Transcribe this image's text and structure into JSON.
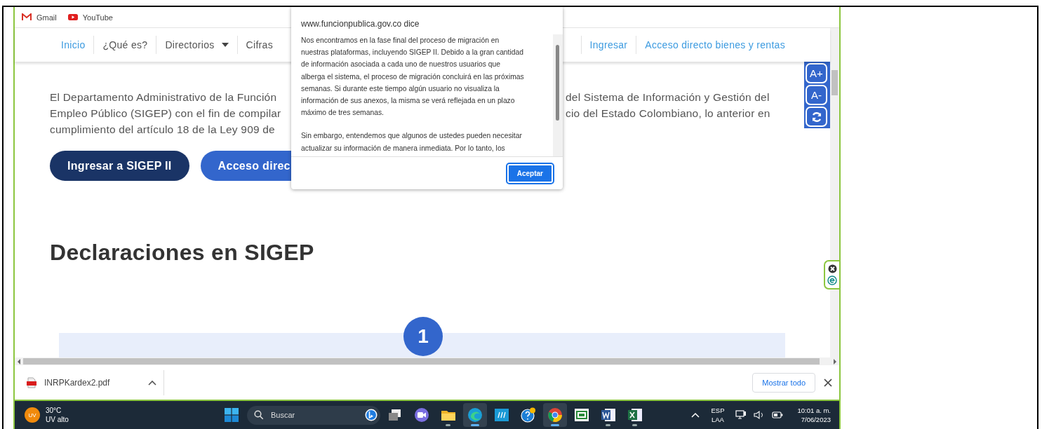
{
  "bookmarks": [
    {
      "label": "Gmail",
      "kind": "mail"
    },
    {
      "label": "YouTube",
      "kind": "video"
    }
  ],
  "nav": {
    "left_items": [
      {
        "label": "Inicio",
        "kind": "accent"
      },
      {
        "label": "¿Qué es?",
        "kind": "plain"
      },
      {
        "label": "Directorios",
        "kind": "dropdown"
      },
      {
        "label": "Cifras",
        "kind": "plain"
      }
    ],
    "right_items": [
      {
        "label": "Ingresar",
        "kind": "accent"
      },
      {
        "label": "Acceso directo bienes y rentas",
        "kind": "accent"
      }
    ]
  },
  "intro": {
    "lines": [
      {
        "left": "El Departamento Administrativo de la Función",
        "right": "del Sistema de Información y Gestión del"
      },
      {
        "left": "Empleo Público (SIGEP) con el fin de compilar",
        "right": "cio del Estado Colombiano, lo anterior en"
      },
      {
        "left": "cumplimiento del artículo 18 de la Ley 909 de"
      }
    ]
  },
  "buttons": [
    {
      "label": "Ingresar a SIGEP II",
      "kind": "dark"
    },
    {
      "label": "Acceso direc",
      "kind": "light"
    }
  ],
  "heading": "Declaraciones en SIGEP",
  "step_badge": "1",
  "font_tools": [
    "A+",
    "A-"
  ],
  "dialog": {
    "title": "www.funcionpublica.gov.co dice",
    "paragraphs": [
      [
        "Nos encontramos en la fase final del proceso de migración en",
        "nuestras plataformas, incluyendo SIGEP II. Debido a la gran cantidad",
        "de información asociada a cada uno de nuestros usuarios que",
        "alberga el sistema, el proceso de migración concluirá en las próximas",
        "semanas. Si durante este tiempo algún usuario no visualiza la",
        "información de sus anexos, la misma se verá reflejada en un plazo",
        "máximo de tres semanas."
      ],
      [
        "Sin embargo, entendemos que algunos de ustedes pueden necesitar",
        "actualizar su información de manera inmediata. Por lo tanto, los"
      ]
    ],
    "button": "Aceptar"
  },
  "downloads": {
    "file": "INRPKardex2.pdf",
    "show_all": "Mostrar todo"
  },
  "taskbar": {
    "weather": {
      "badge": "UV",
      "temperature": "30°C",
      "condition": "UV alto"
    },
    "search_placeholder": "Buscar",
    "apps": [
      {
        "kind": "taskview",
        "running": false,
        "selected": false
      },
      {
        "kind": "chat",
        "running": false,
        "selected": false
      },
      {
        "kind": "folder",
        "running": true,
        "selected": false
      },
      {
        "kind": "edge",
        "running": true,
        "selected": true
      },
      {
        "kind": "hp",
        "running": false,
        "selected": false
      },
      {
        "kind": "help",
        "running": false,
        "selected": false
      },
      {
        "kind": "chrome",
        "running": true,
        "selected": true
      },
      {
        "kind": "green",
        "running": false,
        "selected": false
      },
      {
        "kind": "word",
        "running": true,
        "selected": false
      },
      {
        "kind": "excel",
        "running": true,
        "selected": false
      }
    ],
    "language": [
      "ESP",
      "LAA"
    ],
    "time": "10:01 a. m.",
    "date": "7/06/2023"
  }
}
